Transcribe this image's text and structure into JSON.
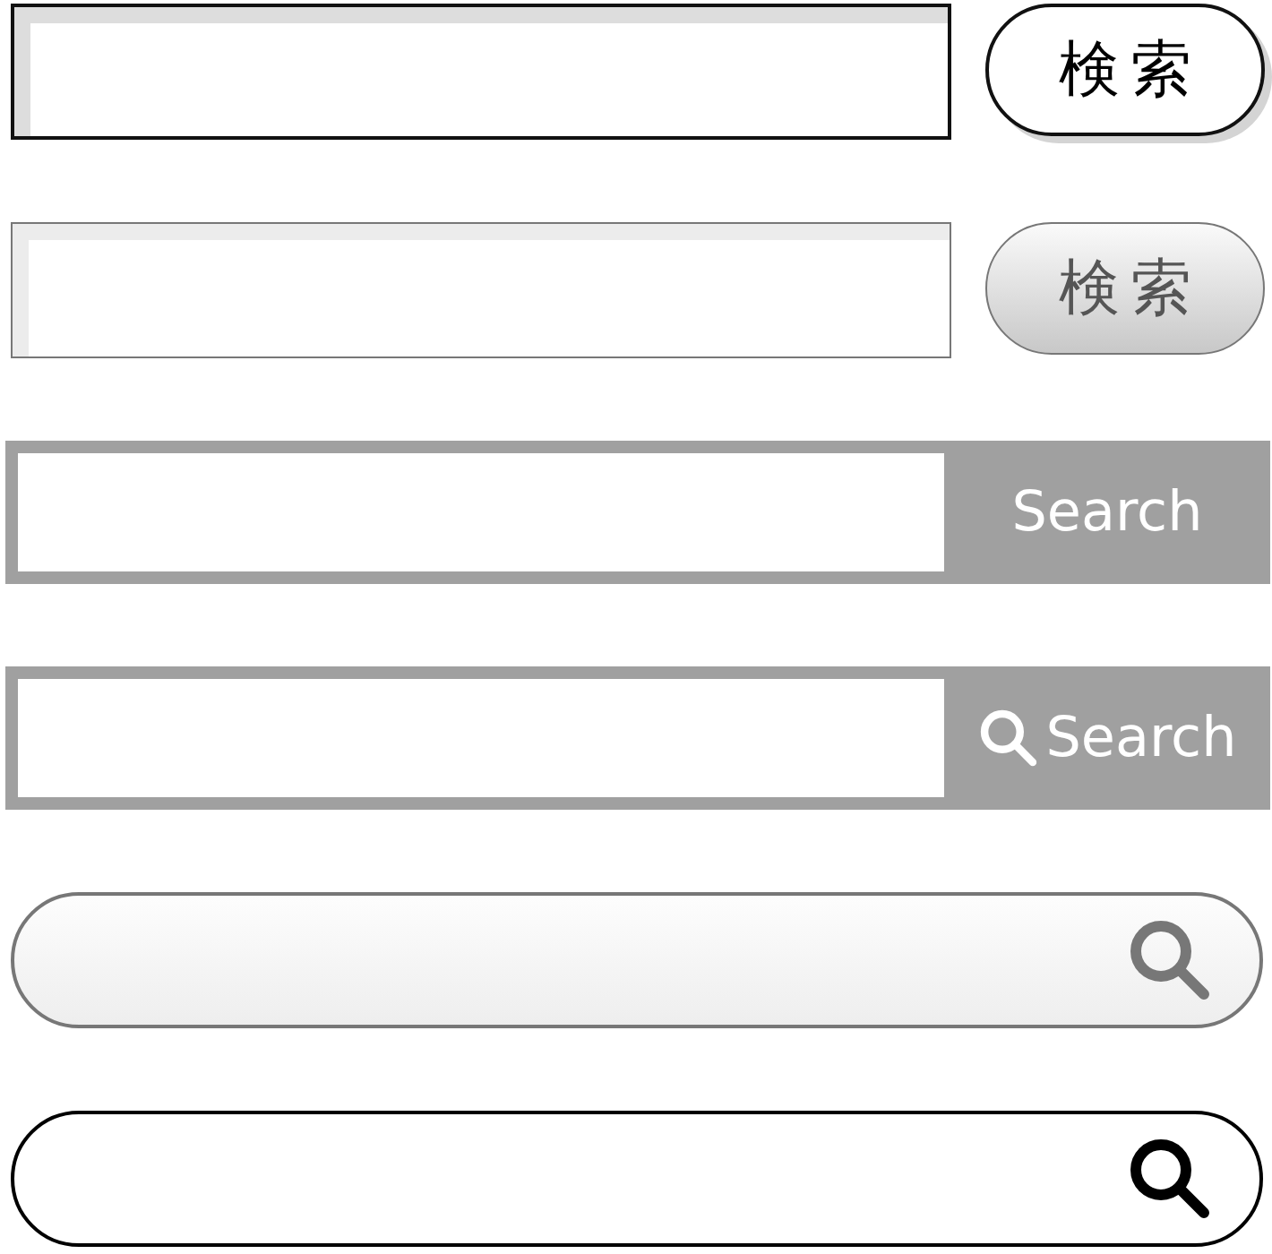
{
  "search_bars": [
    {
      "kind": "outline",
      "button": {
        "label": "検索"
      }
    },
    {
      "kind": "soft",
      "button": {
        "label": "検索"
      }
    },
    {
      "kind": "frame",
      "button": {
        "label": "Search",
        "icon": false
      }
    },
    {
      "kind": "frame",
      "button": {
        "label": "Search",
        "icon": true
      }
    },
    {
      "kind": "softpill"
    },
    {
      "kind": "pill"
    }
  ]
}
